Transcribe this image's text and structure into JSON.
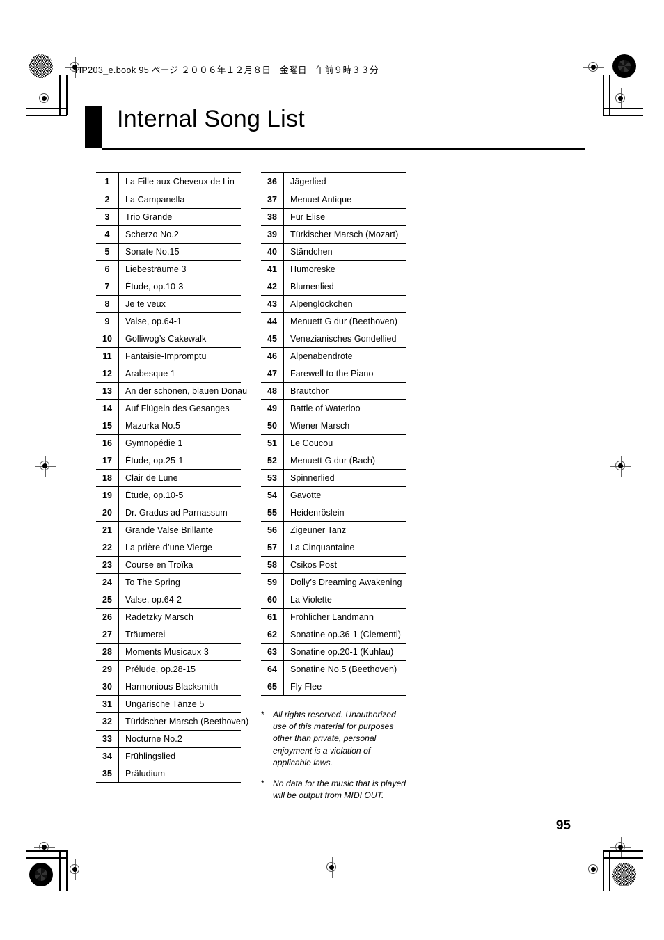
{
  "header": {
    "running_head": "HP203_e.book  95 ページ  ２００６年１２月８日　金曜日　午前９時３３分"
  },
  "title": {
    "text": "Internal Song List"
  },
  "songs": {
    "left_column": [
      {
        "no": "1",
        "name": "La Fille aux Cheveux de Lin"
      },
      {
        "no": "2",
        "name": "La Campanella"
      },
      {
        "no": "3",
        "name": "Trio Grande"
      },
      {
        "no": "4",
        "name": "Scherzo No.2"
      },
      {
        "no": "5",
        "name": "Sonate No.15"
      },
      {
        "no": "6",
        "name": "Liebesträume 3"
      },
      {
        "no": "7",
        "name": "Étude, op.10-3"
      },
      {
        "no": "8",
        "name": "Je te veux"
      },
      {
        "no": "9",
        "name": "Valse, op.64-1"
      },
      {
        "no": "10",
        "name": "Golliwog’s Cakewalk"
      },
      {
        "no": "11",
        "name": "Fantaisie-Impromptu"
      },
      {
        "no": "12",
        "name": "Arabesque 1"
      },
      {
        "no": "13",
        "name": "An der schönen, blauen Donau"
      },
      {
        "no": "14",
        "name": "Auf Flügeln des Gesanges"
      },
      {
        "no": "15",
        "name": "Mazurka No.5"
      },
      {
        "no": "16",
        "name": "Gymnopédie 1"
      },
      {
        "no": "17",
        "name": "Étude, op.25-1"
      },
      {
        "no": "18",
        "name": "Clair de Lune"
      },
      {
        "no": "19",
        "name": "Étude, op.10-5"
      },
      {
        "no": "20",
        "name": "Dr. Gradus ad Parnassum"
      },
      {
        "no": "21",
        "name": "Grande Valse Brillante"
      },
      {
        "no": "22",
        "name": "La prière d’une Vierge"
      },
      {
        "no": "23",
        "name": "Course en Troïka"
      },
      {
        "no": "24",
        "name": "To The Spring"
      },
      {
        "no": "25",
        "name": "Valse, op.64-2"
      },
      {
        "no": "26",
        "name": "Radetzky Marsch"
      },
      {
        "no": "27",
        "name": "Träumerei"
      },
      {
        "no": "28",
        "name": "Moments Musicaux 3"
      },
      {
        "no": "29",
        "name": "Prélude, op.28-15"
      },
      {
        "no": "30",
        "name": "Harmonious Blacksmith"
      },
      {
        "no": "31",
        "name": "Ungarische Tänze 5"
      },
      {
        "no": "32",
        "name": "Türkischer Marsch (Beethoven)"
      },
      {
        "no": "33",
        "name": "Nocturne No.2"
      },
      {
        "no": "34",
        "name": "Frühlingslied"
      },
      {
        "no": "35",
        "name": "Präludium"
      }
    ],
    "right_column": [
      {
        "no": "36",
        "name": "Jägerlied"
      },
      {
        "no": "37",
        "name": "Menuet Antique"
      },
      {
        "no": "38",
        "name": "Für Elise"
      },
      {
        "no": "39",
        "name": "Türkischer Marsch (Mozart)"
      },
      {
        "no": "40",
        "name": "Ständchen"
      },
      {
        "no": "41",
        "name": "Humoreske"
      },
      {
        "no": "42",
        "name": "Blumenlied"
      },
      {
        "no": "43",
        "name": "Alpenglöckchen"
      },
      {
        "no": "44",
        "name": "Menuett G dur (Beethoven)"
      },
      {
        "no": "45",
        "name": "Venezianisches Gondellied"
      },
      {
        "no": "46",
        "name": "Alpenabendröte"
      },
      {
        "no": "47",
        "name": "Farewell to the Piano"
      },
      {
        "no": "48",
        "name": "Brautchor"
      },
      {
        "no": "49",
        "name": "Battle of Waterloo"
      },
      {
        "no": "50",
        "name": "Wiener Marsch"
      },
      {
        "no": "51",
        "name": "Le Coucou"
      },
      {
        "no": "52",
        "name": "Menuett G dur (Bach)"
      },
      {
        "no": "53",
        "name": "Spinnerlied"
      },
      {
        "no": "54",
        "name": "Gavotte"
      },
      {
        "no": "55",
        "name": "Heidenröslein"
      },
      {
        "no": "56",
        "name": "Zigeuner Tanz"
      },
      {
        "no": "57",
        "name": "La Cinquantaine"
      },
      {
        "no": "58",
        "name": "Csikos Post"
      },
      {
        "no": "59",
        "name": "Dolly’s Dreaming Awakening"
      },
      {
        "no": "60",
        "name": "La Violette"
      },
      {
        "no": "61",
        "name": "Fröhlicher Landmann"
      },
      {
        "no": "62",
        "name": "Sonatine op.36-1 (Clementi)"
      },
      {
        "no": "63",
        "name": "Sonatine op.20-1 (Kuhlau)"
      },
      {
        "no": "64",
        "name": "Sonatine No.5 (Beethoven)"
      },
      {
        "no": "65",
        "name": "Fly Flee"
      }
    ]
  },
  "notes": {
    "marker": "*",
    "items": [
      "All rights reserved. Unauthorized use of this material for purposes other than private, personal enjoyment is a violation of applicable laws.",
      "No data for the music that is played will be output from MIDI OUT."
    ]
  },
  "page_number": "95",
  "colors": {
    "ink": "#000000",
    "paper": "#ffffff",
    "regmark": "#666666"
  }
}
